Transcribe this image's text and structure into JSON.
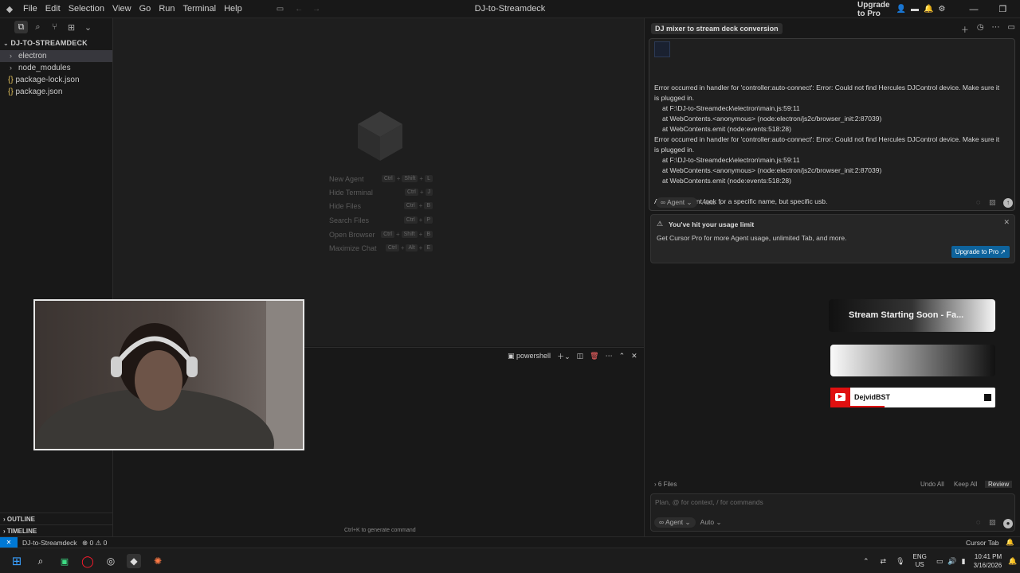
{
  "titlebar": {
    "menu": [
      "File",
      "Edit",
      "Selection",
      "View",
      "Go",
      "Run",
      "Terminal",
      "Help"
    ],
    "window_title": "DJ-to-Streamdeck",
    "upgrade_label": "Upgrade to Pro"
  },
  "sidebar": {
    "root_label": "DJ-TO-STREAMDECK",
    "items": [
      {
        "label": "electron",
        "type": "folder"
      },
      {
        "label": "node_modules",
        "type": "folder"
      },
      {
        "label": "package-lock.json",
        "type": "json"
      },
      {
        "label": "package.json",
        "type": "json"
      }
    ],
    "outline_label": "OUTLINE",
    "timeline_label": "TIMELINE"
  },
  "editor": {
    "shortcuts": [
      {
        "label": "New Agent",
        "keys": [
          "Ctrl",
          "Shift",
          "L"
        ]
      },
      {
        "label": "Hide Terminal",
        "keys": [
          "Ctrl",
          "J"
        ]
      },
      {
        "label": "Hide Files",
        "keys": [
          "Ctrl",
          "B"
        ]
      },
      {
        "label": "Search Files",
        "keys": [
          "Ctrl",
          "P"
        ]
      },
      {
        "label": "Open Browser",
        "keys": [
          "Ctrl",
          "Shift",
          "B"
        ]
      },
      {
        "label": "Maximize Chat",
        "keys": [
          "Ctrl",
          "Alt",
          "E"
        ]
      }
    ]
  },
  "terminal": {
    "shell_label": "powershell",
    "hint": "Ctrl+K to generate command"
  },
  "chat": {
    "tab_title": "DJ mixer to stream deck conversion",
    "message_lines": [
      {
        "text": "Error occurred in handler for 'controller:auto-connect': Error: Could not find Hercules DJControl device. Make sure it",
        "indent": false
      },
      {
        "text": "is plugged in.",
        "indent": false
      },
      {
        "text": "at F:\\DJ-to-Streamdeck\\electron\\main.js:59:11",
        "indent": true
      },
      {
        "text": "at WebContents.<anonymous> (node:electron/js2c/browser_init:2:87039)",
        "indent": true
      },
      {
        "text": "at WebContents.emit (node:events:518:28)",
        "indent": true
      },
      {
        "text": "Error occurred in handler for 'controller:auto-connect': Error: Could not find Hercules DJControl device. Make sure it",
        "indent": false
      },
      {
        "text": "is plugged in.",
        "indent": false
      },
      {
        "text": "at F:\\DJ-to-Streamdeck\\electron\\main.js:59:11",
        "indent": true
      },
      {
        "text": "at WebContents.<anonymous> (node:electron/js2c/browser_init:2:87039)",
        "indent": true
      },
      {
        "text": "at WebContents.emit (node:events:518:28)",
        "indent": true
      },
      {
        "text": "",
        "indent": false
      },
      {
        "text": "Also, it shouldnt look for a specific name, but specific usb.",
        "indent": false
      }
    ],
    "agent_label": "Agent",
    "auto_label": "Auto",
    "limit_title": "You've hit your usage limit",
    "limit_desc": "Get Cursor Pro for more Agent usage, unlimited Tab, and more.",
    "upgrade_btn": "Upgrade to Pro",
    "files_label": "6 Files",
    "undo_all": "Undo All",
    "keep_all": "Keep All",
    "review": "Review",
    "input_placeholder": "Plan, @ for context, / for commands"
  },
  "overlay": {
    "stream_banner": "Stream Starting Soon - Fa...",
    "youtube_name": "DejvidBST"
  },
  "statusbar": {
    "project": "DJ-to-Streamdeck",
    "errors": "0",
    "warnings": "0",
    "cursor_tab": "Cursor Tab"
  },
  "taskbar": {
    "lang": "ENG",
    "region": "US",
    "time": "10:41 PM",
    "date": "3/16/2026"
  }
}
